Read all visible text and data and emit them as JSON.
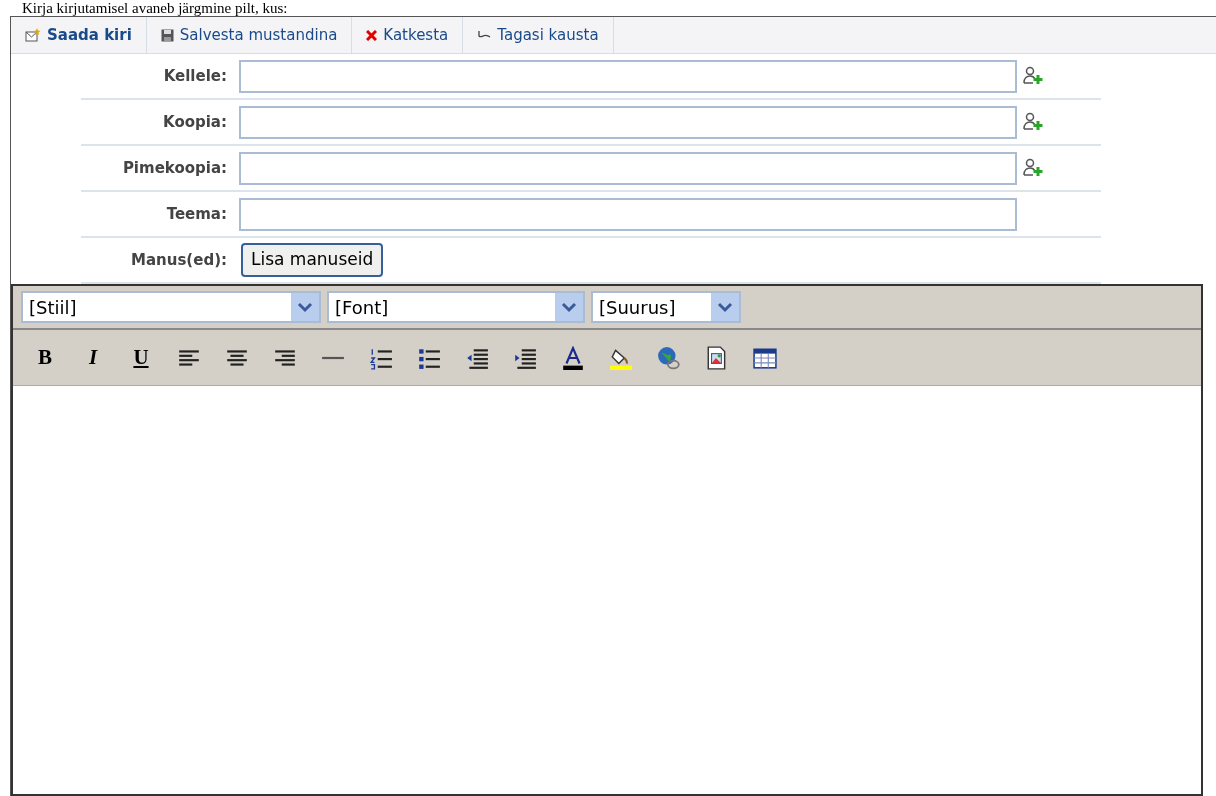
{
  "caption": "Kirja kirjutamisel avaneb järgmine pilt, kus:",
  "toolbar": [
    {
      "label": "Saada kiri",
      "kind": "send"
    },
    {
      "label": "Salvesta mustandina",
      "kind": "save"
    },
    {
      "label": "Katkesta",
      "kind": "cancel"
    },
    {
      "label": "Tagasi kausta",
      "kind": "back"
    }
  ],
  "fields": [
    {
      "label": "Kellele:",
      "kind": "address"
    },
    {
      "label": "Koopia:",
      "kind": "address"
    },
    {
      "label": "Pimekoopia:",
      "kind": "address"
    },
    {
      "label": "Teema:",
      "kind": "text"
    },
    {
      "label": "Manus(ed):",
      "kind": "attach",
      "button": "Lisa manuseid"
    }
  ],
  "editor": {
    "selects": [
      "[Stiil]",
      "[Font]",
      "[Suurus]"
    ],
    "buttons": [
      {
        "kind": "bold",
        "text": "B"
      },
      {
        "kind": "italic",
        "text": "I"
      },
      {
        "kind": "underline",
        "text": "U"
      },
      {
        "kind": "align-left"
      },
      {
        "kind": "align-center"
      },
      {
        "kind": "align-right"
      },
      {
        "kind": "rule"
      },
      {
        "kind": "ordered-list"
      },
      {
        "kind": "unordered-list"
      },
      {
        "kind": "outdent"
      },
      {
        "kind": "indent"
      },
      {
        "kind": "text-color"
      },
      {
        "kind": "highlight"
      },
      {
        "kind": "link"
      },
      {
        "kind": "image"
      },
      {
        "kind": "table"
      }
    ]
  }
}
